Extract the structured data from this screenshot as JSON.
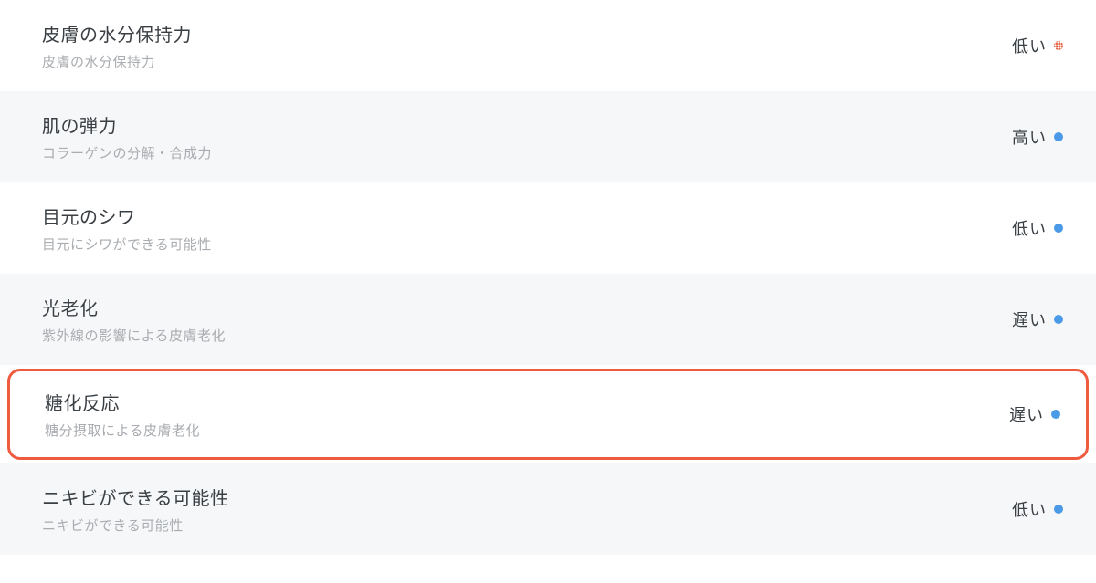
{
  "items": [
    {
      "title": "皮膚の水分保持力",
      "subtitle": "皮膚の水分保持力",
      "value": "低い",
      "dotColor": "red-pattern",
      "highlighted": false,
      "alt": false
    },
    {
      "title": "肌の弾力",
      "subtitle": "コラーゲンの分解・合成力",
      "value": "高い",
      "dotColor": "blue",
      "highlighted": false,
      "alt": true
    },
    {
      "title": "目元のシワ",
      "subtitle": "目元にシワができる可能性",
      "value": "低い",
      "dotColor": "blue",
      "highlighted": false,
      "alt": false
    },
    {
      "title": "光老化",
      "subtitle": "紫外線の影響による皮膚老化",
      "value": "遅い",
      "dotColor": "blue",
      "highlighted": false,
      "alt": true
    },
    {
      "title": "糖化反応",
      "subtitle": "糖分摂取による皮膚老化",
      "value": "遅い",
      "dotColor": "blue",
      "highlighted": true,
      "alt": false
    },
    {
      "title": "ニキビができる可能性",
      "subtitle": "ニキビができる可能性",
      "value": "低い",
      "dotColor": "blue",
      "highlighted": false,
      "alt": true
    }
  ]
}
